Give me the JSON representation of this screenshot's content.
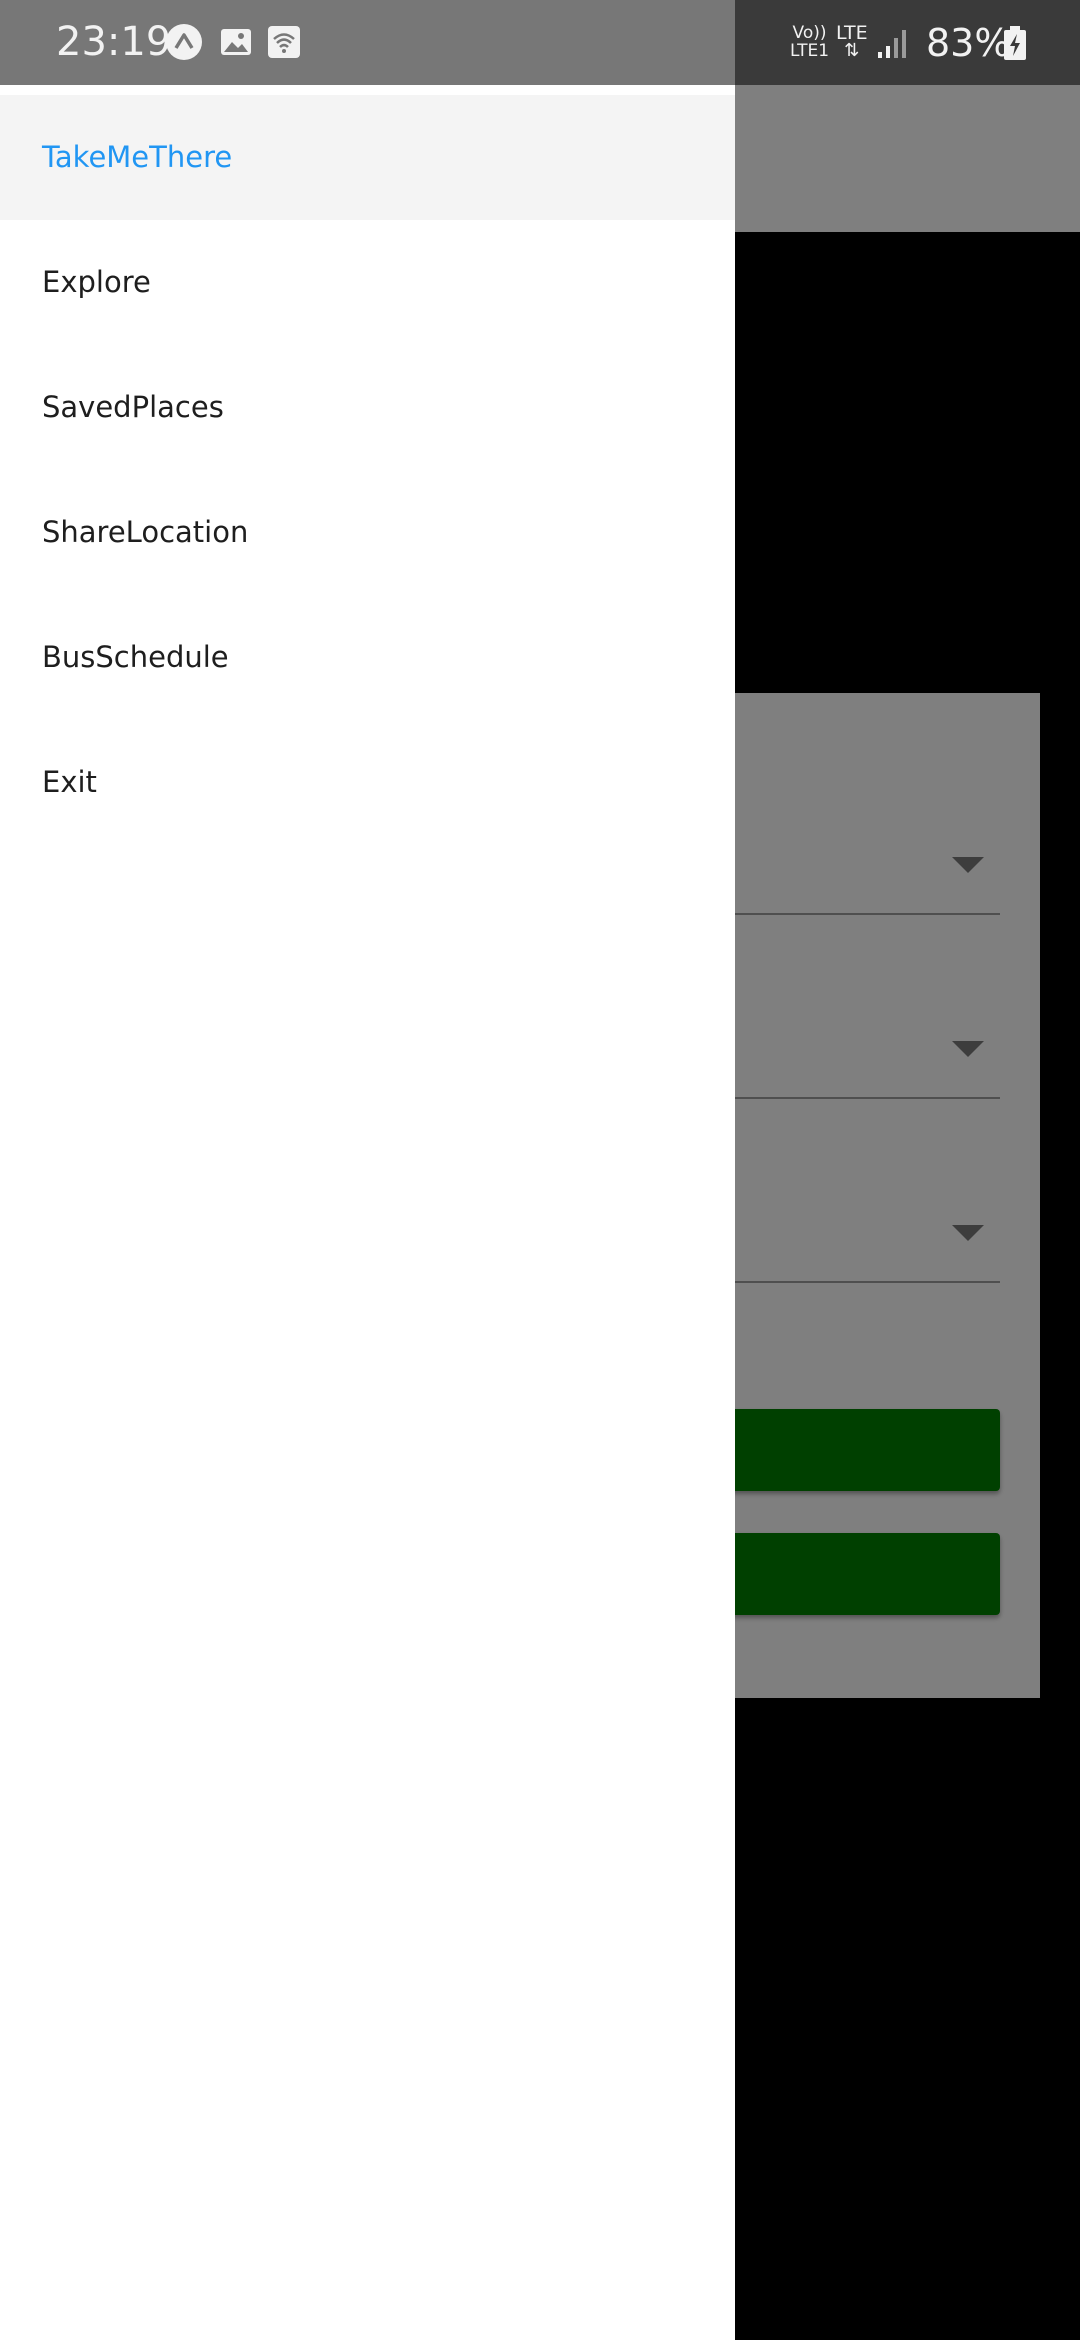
{
  "status_bar": {
    "time": "23:19",
    "volte_label_top": "Vo))",
    "volte_label_bottom": "LTE1",
    "network_label": "LTE",
    "battery_percent": "83%",
    "icons": [
      "app-notification-icon",
      "image-icon",
      "wifi-hotspot-icon",
      "signal-icon",
      "battery-charging-icon"
    ]
  },
  "drawer": {
    "items": [
      {
        "label": "TakeMeThere",
        "active": true
      },
      {
        "label": "Explore",
        "active": false
      },
      {
        "label": "SavedPlaces",
        "active": false
      },
      {
        "label": "ShareLocation",
        "active": false
      },
      {
        "label": "BusSchedule",
        "active": false
      },
      {
        "label": "Exit",
        "active": false
      }
    ]
  },
  "colors": {
    "active_item_text": "#2196f3",
    "active_item_bg": "#f4f4f4",
    "primary_button": "#008000",
    "scrim": "rgba(0,0,0,0.5)"
  }
}
